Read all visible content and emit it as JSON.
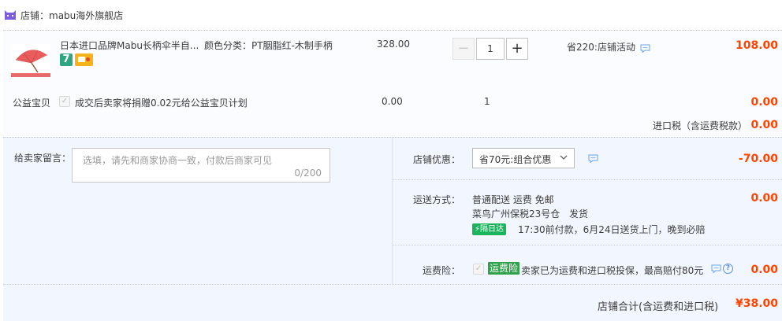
{
  "shop": {
    "name": "店铺：mabu海外旗舰店",
    "icon": "tmall-cat-icon"
  },
  "item": {
    "title": "日本进口品牌Mabu长柄伞半自...",
    "sku": "颜色分类：PT胭脂红-木制手柄",
    "price": "328.00",
    "quantity": "1",
    "minus": "−",
    "plus": "+",
    "promo": "省220:店铺活动",
    "total": "108.00",
    "badge_seven": "7",
    "colors": {
      "accent": "#ff4400",
      "thumb": "#e85c5c"
    }
  },
  "charity": {
    "label": "公益宝贝",
    "checkbox": "✓",
    "text": "成交后卖家将捐赠0.02元给公益宝贝计划",
    "price": "0.00",
    "quantity": "1",
    "total": "0.00"
  },
  "import_tax": {
    "label": "进口税（含运费税款）",
    "amount": "0.00"
  },
  "message": {
    "label": "给卖家留言：",
    "placeholder": "选填，请先和商家协商一致，付款后商家可见",
    "count": "0/200"
  },
  "discount": {
    "label": "店铺优惠：",
    "selected": "省70元:组合优惠",
    "amount": "-70.00"
  },
  "shipping": {
    "label": "运送方式：",
    "method": "普通配送 运费 免邮",
    "warehouse": "菜鸟广州保税23号仓",
    "ship_label": "发货",
    "badge": "隔日达",
    "eta": "17:30前付款，6月24日送货上门，晚到必赔",
    "amount": "0.00"
  },
  "insurance": {
    "label": "运费险：",
    "checkbox": "✓",
    "tag": "运费险",
    "text": "卖家已为运费和进口税投保，最高赔付80元",
    "help": "?",
    "amount": "0.00"
  },
  "summary": {
    "label": "店铺合计(含运费和进口税)",
    "amount": "¥38.00"
  }
}
